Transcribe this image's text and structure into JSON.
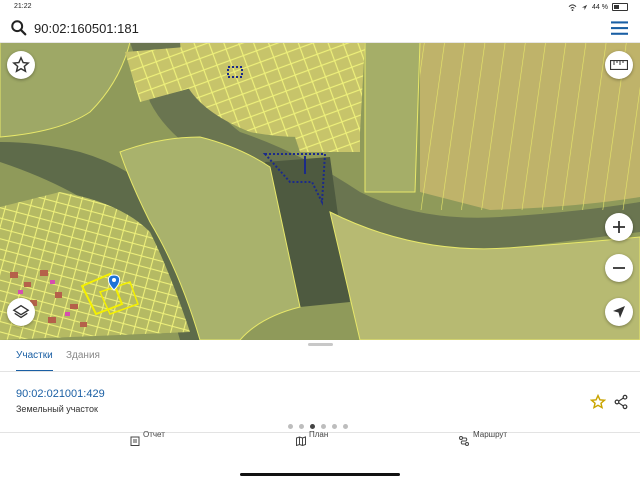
{
  "status_bar": {
    "time": "21:22",
    "battery": "44 %"
  },
  "search": {
    "query": "90:02:160501:181"
  },
  "map": {
    "icons": [
      "star-icon",
      "ruler-icon",
      "zoom-in-icon",
      "zoom-out-icon",
      "layers-icon",
      "location-arrow-icon"
    ],
    "colors": {
      "parcel_outline": "#e8e86a",
      "parcel_fill": "#d8d86a",
      "selected_outline": "#1b2a8a",
      "marker": "#1e73d8"
    }
  },
  "panel": {
    "tabs": [
      {
        "label": "Участки",
        "active": true
      },
      {
        "label": "Здания",
        "active": false
      }
    ],
    "parcel": {
      "number": "90:02:021001:429",
      "type": "Земельный участок"
    },
    "pager": {
      "count": 6,
      "active_index": 2
    },
    "nav": [
      {
        "label": "Отчет",
        "icon": "report-icon"
      },
      {
        "label": "План",
        "icon": "map-plan-icon"
      },
      {
        "label": "Маршрут",
        "icon": "route-icon"
      }
    ]
  },
  "colors": {
    "accent": "#1a5fa4"
  }
}
